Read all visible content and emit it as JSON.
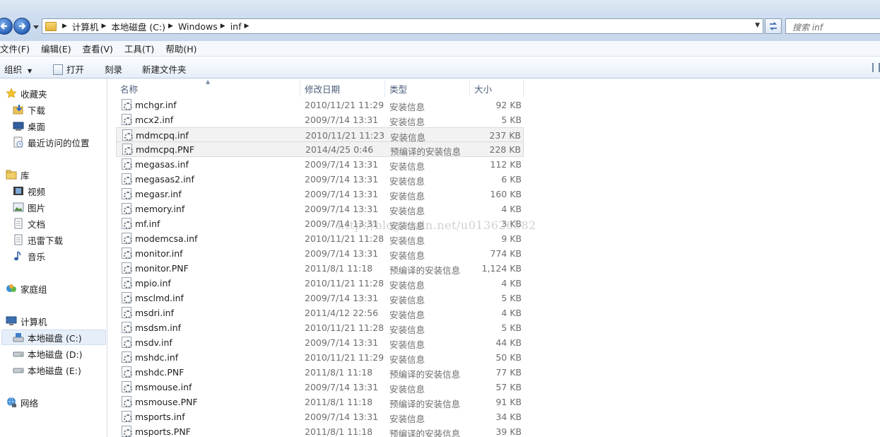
{
  "address_bar": {
    "breadcrumbs": [
      "计算机",
      "本地磁盘 (C:)",
      "Windows",
      "inf"
    ]
  },
  "search": {
    "placeholder": "搜索 inf"
  },
  "menu": [
    "文件(F)",
    "编辑(E)",
    "查看(V)",
    "工具(T)",
    "帮助(H)"
  ],
  "toolbar": {
    "organize": "组织",
    "open": "打开",
    "burn": "刻录",
    "new_folder": "新建文件夹"
  },
  "sidebar": {
    "favorites": {
      "label": "收藏夹",
      "items": [
        "下载",
        "桌面",
        "最近访问的位置"
      ]
    },
    "libraries": {
      "label": "库",
      "items": [
        "视频",
        "图片",
        "文档",
        "迅雷下载",
        "音乐"
      ]
    },
    "homegroup": "家庭组",
    "computer": {
      "label": "计算机",
      "items": [
        "本地磁盘 (C:)",
        "本地磁盘 (D:)",
        "本地磁盘 (E:)"
      ]
    },
    "network": "网络"
  },
  "columns": {
    "name": "名称",
    "date": "修改日期",
    "type": "类型",
    "size": "大小"
  },
  "files": [
    {
      "name": "mchgr.inf",
      "date": "2010/11/21 11:29",
      "type": "安装信息",
      "size": "92 KB"
    },
    {
      "name": "mcx2.inf",
      "date": "2009/7/14 13:31",
      "type": "安装信息",
      "size": "5 KB"
    },
    {
      "name": "mdmcpq.inf",
      "date": "2010/11/21 11:23",
      "type": "安装信息",
      "size": "237 KB"
    },
    {
      "name": "mdmcpq.PNF",
      "date": "2014/4/25 0:46",
      "type": "预编译的安装信息",
      "size": "228 KB"
    },
    {
      "name": "megasas.inf",
      "date": "2009/7/14 13:31",
      "type": "安装信息",
      "size": "112 KB"
    },
    {
      "name": "megasas2.inf",
      "date": "2009/7/14 13:31",
      "type": "安装信息",
      "size": "6 KB"
    },
    {
      "name": "megasr.inf",
      "date": "2009/7/14 13:31",
      "type": "安装信息",
      "size": "160 KB"
    },
    {
      "name": "memory.inf",
      "date": "2009/7/14 13:31",
      "type": "安装信息",
      "size": "4 KB"
    },
    {
      "name": "mf.inf",
      "date": "2009/7/14 13:31",
      "type": "安装信息",
      "size": "3 KB"
    },
    {
      "name": "modemcsa.inf",
      "date": "2010/11/21 11:28",
      "type": "安装信息",
      "size": "9 KB"
    },
    {
      "name": "monitor.inf",
      "date": "2009/7/14 13:31",
      "type": "安装信息",
      "size": "774 KB"
    },
    {
      "name": "monitor.PNF",
      "date": "2011/8/1 11:18",
      "type": "预编译的安装信息",
      "size": "1,124 KB"
    },
    {
      "name": "mpio.inf",
      "date": "2010/11/21 11:28",
      "type": "安装信息",
      "size": "4 KB"
    },
    {
      "name": "msclmd.inf",
      "date": "2009/7/14 13:31",
      "type": "安装信息",
      "size": "5 KB"
    },
    {
      "name": "msdri.inf",
      "date": "2011/4/12 22:56",
      "type": "安装信息",
      "size": "4 KB"
    },
    {
      "name": "msdsm.inf",
      "date": "2010/11/21 11:28",
      "type": "安装信息",
      "size": "5 KB"
    },
    {
      "name": "msdv.inf",
      "date": "2009/7/14 13:31",
      "type": "安装信息",
      "size": "44 KB"
    },
    {
      "name": "mshdc.inf",
      "date": "2010/11/21 11:29",
      "type": "安装信息",
      "size": "50 KB"
    },
    {
      "name": "mshdc.PNF",
      "date": "2011/8/1 11:18",
      "type": "预编译的安装信息",
      "size": "77 KB"
    },
    {
      "name": "msmouse.inf",
      "date": "2009/7/14 13:31",
      "type": "安装信息",
      "size": "57 KB"
    },
    {
      "name": "msmouse.PNF",
      "date": "2011/8/1 11:18",
      "type": "预编译的安装信息",
      "size": "91 KB"
    },
    {
      "name": "msports.inf",
      "date": "2009/7/14 13:31",
      "type": "安装信息",
      "size": "34 KB"
    },
    {
      "name": "msports.PNF",
      "date": "2011/8/1 11:18",
      "type": "预编译的安装信息",
      "size": "39 KB"
    }
  ],
  "watermark": "http://blog.csdn.net/u013626582"
}
